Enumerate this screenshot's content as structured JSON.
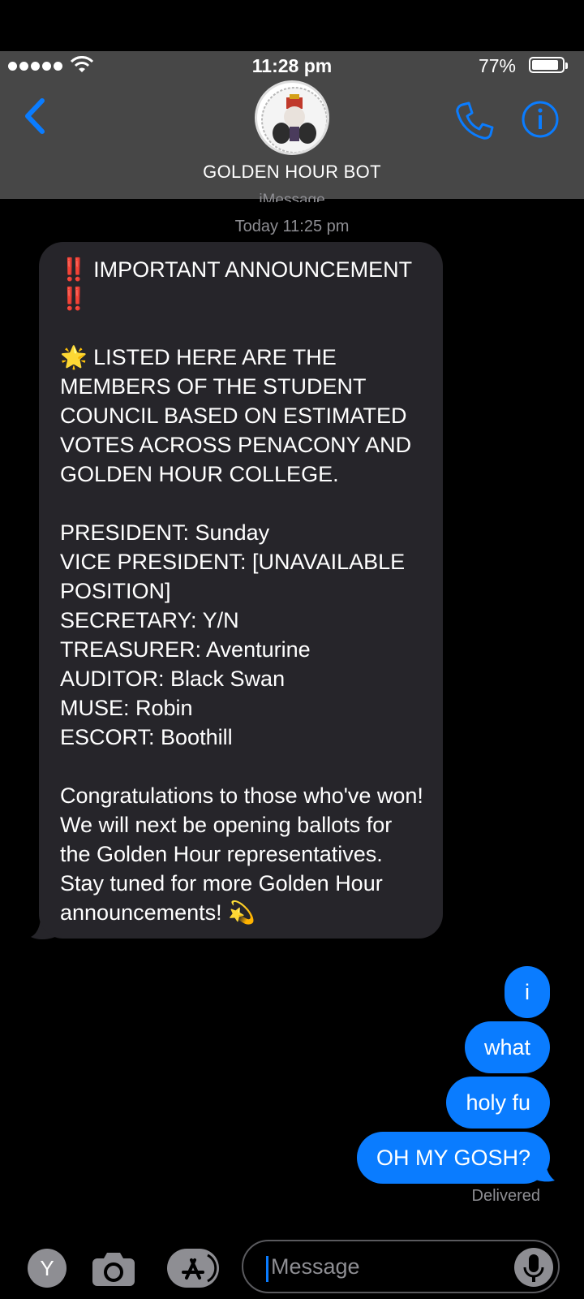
{
  "status_bar": {
    "time": "11:28 pm",
    "battery": "77%",
    "signal_bars": 5
  },
  "contact": {
    "name": "GOLDEN HOUR BOT"
  },
  "thread": {
    "service_label": "iMessage",
    "timestamp": "Today 11:25 pm"
  },
  "incoming_message": {
    "line1": "‼️ IMPORTANT ANNOUNCEMENT ‼️",
    "line2": "🌟 LISTED HERE ARE THE MEMBERS OF THE STUDENT COUNCIL BASED ON ESTIMATED VOTES ACROSS PENACONY AND GOLDEN HOUR COLLEGE.",
    "roster": [
      "PRESIDENT: Sunday",
      "VICE PRESIDENT: [UNAVAILABLE POSITION]",
      "SECRETARY: Y/N",
      "TREASURER: Aventurine",
      "AUDITOR: Black Swan",
      "MUSE: Robin",
      "ESCORT: Boothill"
    ],
    "closing": "Congratulations to those who've won! We will next be opening ballots for the Golden Hour representatives. Stay tuned for more Golden Hour announcements! 💫"
  },
  "outgoing_messages": [
    "i",
    "what",
    "holy fu",
    "OH MY GOSH?"
  ],
  "delivery_status": "Delivered",
  "input_bar": {
    "placeholder": "Message",
    "avatar_letter": "Y"
  },
  "colors": {
    "accent": "#0a7cff",
    "incoming_bubble": "#26252a",
    "header": "#474747"
  }
}
